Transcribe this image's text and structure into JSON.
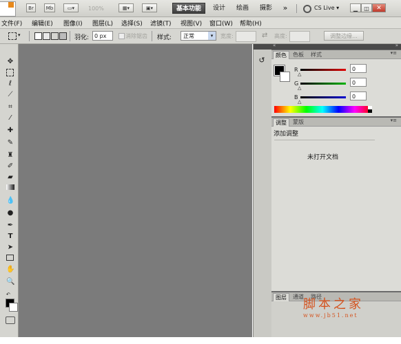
{
  "appbar": {
    "br_label": "Br",
    "mb_label": "Mb",
    "zoom": "100%",
    "workspaces": [
      "基本功能",
      "设计",
      "绘画",
      "摄影"
    ],
    "more": "»",
    "cslive": "CS Live"
  },
  "menu": [
    "文件(F)",
    "编辑(E)",
    "图像(I)",
    "图层(L)",
    "选择(S)",
    "滤镜(T)",
    "视图(V)",
    "窗口(W)",
    "帮助(H)"
  ],
  "options": {
    "feather_label": "羽化:",
    "feather_value": "0 px",
    "antialias_label": "消除锯齿",
    "style_label": "样式:",
    "style_value": "正常",
    "width_label": "宽度:",
    "height_label": "高度:",
    "refine_label": "调整边缘..."
  },
  "color_panel": {
    "tabs": [
      "颜色",
      "色板",
      "样式"
    ],
    "channels": [
      {
        "label": "R",
        "value": "0"
      },
      {
        "label": "G",
        "value": "0"
      },
      {
        "label": "B",
        "value": "0"
      }
    ]
  },
  "adjust_panel": {
    "tabs": [
      "调整",
      "蒙版"
    ],
    "title": "添加调整",
    "message": "未打开文档"
  },
  "layers_panel": {
    "tabs": [
      "图层",
      "通道",
      "路径"
    ]
  },
  "watermark": {
    "title": "脚本之家",
    "url": "www.jb51.net"
  }
}
